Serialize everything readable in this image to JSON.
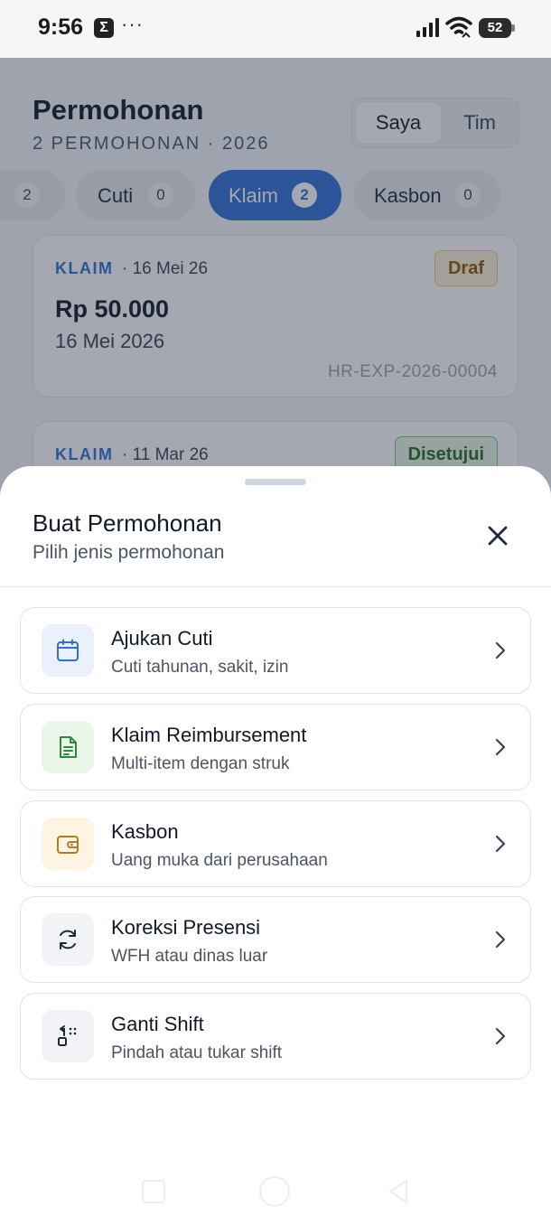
{
  "status_bar": {
    "time": "9:56",
    "notification_icon_letter": "Σ",
    "more_dots": "···",
    "battery_level": "52"
  },
  "header": {
    "title": "Permohonan",
    "subtitle": "2 PERMOHONAN · 2026",
    "scope_options": [
      "Saya",
      "Tim"
    ],
    "scope_selected": "Saya"
  },
  "filter_chips": [
    {
      "label": "",
      "count": "2",
      "partial": true
    },
    {
      "label": "Cuti",
      "count": "0"
    },
    {
      "label": "Klaim",
      "count": "2",
      "active": true
    },
    {
      "label": "Kasbon",
      "count": "0"
    }
  ],
  "requests": [
    {
      "type": "KLAIM",
      "date": "· 16 Mei 26",
      "status": "Draf",
      "amount": "Rp 50.000",
      "full_date": "16 Mei 2026",
      "ref": "HR-EXP-2026-00004"
    },
    {
      "type": "KLAIM",
      "date": "· 11 Mar 26",
      "status": "Disetujui"
    }
  ],
  "sheet": {
    "title": "Buat Permohonan",
    "subtitle": "Pilih jenis permohonan",
    "options": [
      {
        "title": "Ajukan Cuti",
        "desc": "Cuti tahunan, sakit, izin",
        "icon": "calendar-icon",
        "icon_color": "#2f6fd6",
        "icon_bg": "#eaf1fb"
      },
      {
        "title": "Klaim Reimbursement",
        "desc": "Multi-item dengan struk",
        "icon": "receipt-icon",
        "icon_color": "#2e8b3a",
        "icon_bg": "#eaf6ea"
      },
      {
        "title": "Kasbon",
        "desc": "Uang muka dari perusahaan",
        "icon": "wallet-icon",
        "icon_color": "#b7791f",
        "icon_bg": "#fdf5e1"
      },
      {
        "title": "Koreksi Presensi",
        "desc": "WFH atau dinas luar",
        "icon": "refresh-icon",
        "icon_color": "#1f2937",
        "icon_bg": "#f1f3f6"
      },
      {
        "title": "Ganti Shift",
        "desc": "Pindah atau tukar shift",
        "icon": "shift-swap-icon",
        "icon_color": "#1f2937",
        "icon_bg": "#f1f3f6"
      }
    ]
  }
}
